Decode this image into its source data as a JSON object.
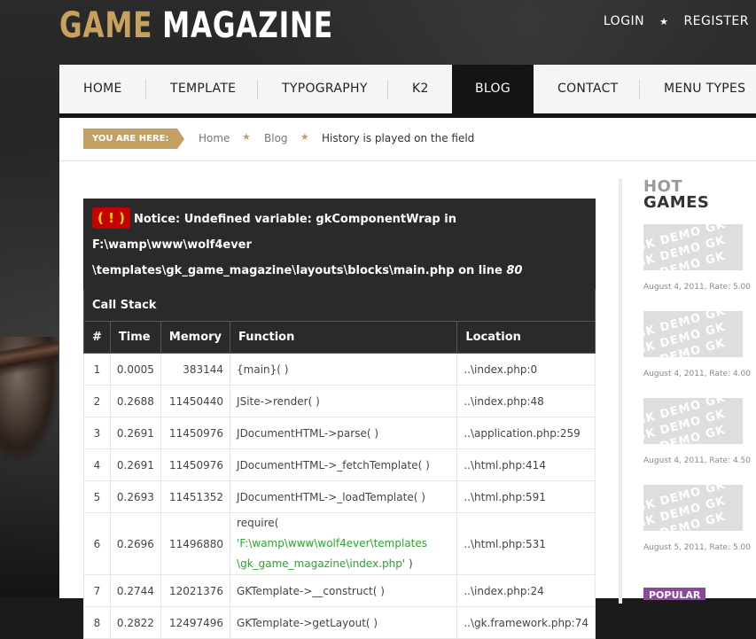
{
  "header": {
    "logo_part1": "GAME",
    "logo_part2": "MAGAZINE",
    "login": "LOGIN",
    "register": "REGISTER"
  },
  "nav": {
    "items": [
      {
        "label": "HOME"
      },
      {
        "label": "TEMPLATE"
      },
      {
        "label": "TYPOGRAPHY"
      },
      {
        "label": "K2"
      },
      {
        "label": "BLOG",
        "active": true
      },
      {
        "label": "CONTACT"
      },
      {
        "label": "MENU TYPES"
      }
    ]
  },
  "breadcrumb": {
    "label": "YOU ARE HERE:",
    "items": [
      "Home",
      "Blog",
      "History is played on the field"
    ]
  },
  "error": {
    "badge": "( ! )",
    "notice_line1": "Notice: Undefined variable: gkComponentWrap in F:\\wamp\\www\\wolf4ever",
    "notice_line2": "\\templates\\gk_game_magazine\\layouts\\blocks\\main.php on line ",
    "line_number": "80",
    "call_stack": "Call Stack",
    "columns": [
      "#",
      "Time",
      "Memory",
      "Function",
      "Location"
    ],
    "rows": [
      {
        "n": "1",
        "time": "0.0005",
        "memory": "383144",
        "func": "{main}( )",
        "loc": "..\\index.php:0"
      },
      {
        "n": "2",
        "time": "0.2688",
        "memory": "11450440",
        "func": "JSite->render( )",
        "loc": "..\\index.php:48"
      },
      {
        "n": "3",
        "time": "0.2691",
        "memory": "11450976",
        "func": "JDocumentHTML->parse( )",
        "loc": "..\\application.php:259"
      },
      {
        "n": "4",
        "time": "0.2691",
        "memory": "11450976",
        "func": "JDocumentHTML->_fetchTemplate( )",
        "loc": "..\\html.php:414"
      },
      {
        "n": "5",
        "time": "0.2693",
        "memory": "11451352",
        "func": "JDocumentHTML->_loadTemplate( )",
        "loc": "..\\html.php:591"
      },
      {
        "n": "6",
        "time": "0.2696",
        "memory": "11496880",
        "func_prefix": "require( ",
        "func_green1": "'F:\\wamp\\www\\wolf4ever\\templates",
        "func_green2": "\\gk_game_magazine\\index.php'",
        "func_suffix": " )",
        "loc": "..\\html.php:531"
      },
      {
        "n": "7",
        "time": "0.2744",
        "memory": "12021376",
        "func": "GKTemplate->__construct( )",
        "loc": "..\\index.php:24"
      },
      {
        "n": "8",
        "time": "0.2822",
        "memory": "12497496",
        "func": "GKTemplate->getLayout( )",
        "loc": "..\\gk.framework.php:74"
      }
    ]
  },
  "sidebar": {
    "hot": "HOT",
    "games": "GAMES",
    "thumb_text": "GK DEMO GK",
    "items": [
      {
        "meta": "August 4, 2011, Rate: 5.00"
      },
      {
        "meta": "August 4, 2011, Rate: 4.00"
      },
      {
        "meta": "August 4, 2011, Rate: 4.50"
      },
      {
        "meta": "August 5, 2011, Rate: 5.00"
      }
    ],
    "popular": "POPULAR"
  }
}
